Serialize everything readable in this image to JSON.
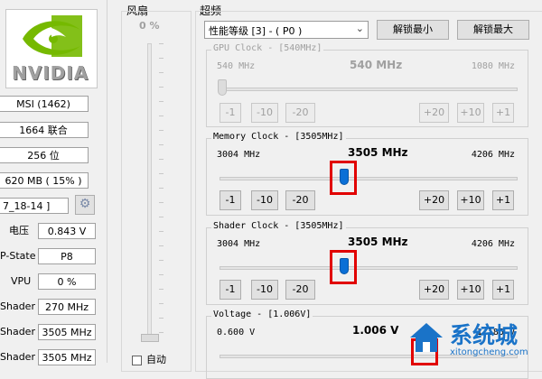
{
  "logo": {
    "brand": "NVIDIA"
  },
  "left_panel": {
    "vendor": "MSI (1462)",
    "shaders": "1664 联合",
    "bus_width": "256 位",
    "memory_usage": "620 MB ( 15% )",
    "driver_date": "7_18-14 ]",
    "voltage_label": "电压",
    "voltage_value": "0.843 V",
    "pstate_label": "P-State",
    "pstate_value": "P8",
    "vpu_label": "VPU",
    "vpu_value": "0 %",
    "shader1_label": "Shader",
    "shader1_value": "270 MHz",
    "shader2_label": "Shader",
    "shader2_value": "3505 MHz",
    "shader3_label": "Shader",
    "shader3_value": "3505 MHz"
  },
  "fan": {
    "title": "风扇",
    "percent": "0 %",
    "auto_label": "自动"
  },
  "overclock": {
    "title": "超频",
    "perf_level_select": "性能等级 [3] - ( P0 )",
    "unlock_min_label": "解锁最小",
    "unlock_max_label": "解锁最大",
    "gpu_clock": {
      "title": "GPU Clock - [540MHz]",
      "min": "540 MHz",
      "current": "540 MHz",
      "max": "1080 MHz",
      "value": 540,
      "range": [
        540,
        1080
      ],
      "buttons": [
        "-1",
        "-10",
        "-20",
        "+20",
        "+10",
        "+1"
      ]
    },
    "memory_clock": {
      "title": "Memory Clock - [3505MHz]",
      "min": "3004 MHz",
      "current": "3505 MHz",
      "max": "4206 MHz",
      "value": 3505,
      "range": [
        3004,
        4206
      ],
      "buttons": [
        "-1",
        "-10",
        "-20",
        "+20",
        "+10",
        "+1"
      ]
    },
    "shader_clock": {
      "title": "Shader Clock - [3505MHz]",
      "min": "3004 MHz",
      "current": "3505 MHz",
      "max": "4206 MHz",
      "value": 3505,
      "range": [
        3004,
        4206
      ],
      "buttons": [
        "-1",
        "-10",
        "-20",
        "+20",
        "+10",
        "+1"
      ]
    },
    "voltage": {
      "title": "Voltage - [1.006V]",
      "min": "0.600 V",
      "current": "1.006 V",
      "max": "1.185 V"
    }
  },
  "watermark": {
    "text_cn": "系统城",
    "text_url": "xitongcheng.com"
  },
  "colors": {
    "thumb": "#0a6fd6",
    "highlight": "#e10000",
    "watermark_blue": "#1a73c8"
  }
}
